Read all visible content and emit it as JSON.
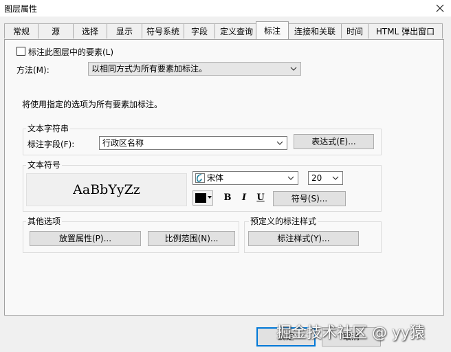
{
  "window": {
    "title": "图层属性"
  },
  "tabs": [
    {
      "label": "常规"
    },
    {
      "label": "源"
    },
    {
      "label": "选择"
    },
    {
      "label": "显示"
    },
    {
      "label": "符号系统"
    },
    {
      "label": "字段"
    },
    {
      "label": "定义查询"
    },
    {
      "label": "标注"
    },
    {
      "label": "连接和关联"
    },
    {
      "label": "时间"
    },
    {
      "label": "HTML 弹出窗口"
    }
  ],
  "labeling": {
    "enable_label": "标注此图层中的要素(L)",
    "method_label": "方法(M):",
    "method_value": "以相同方式为所有要素加标注。",
    "info_text": "将使用指定的选项为所有要素加标注。",
    "text_string": {
      "group_title": "文本字符串",
      "field_label": "标注字段(F):",
      "field_value": "行政区名称",
      "expression_button": "表达式(E)..."
    },
    "text_symbol": {
      "group_title": "文本符号",
      "preview_text": "AaBbYyZz",
      "font_value": "宋体",
      "size_value": "20",
      "color": "#000000",
      "bold": "B",
      "italic": "I",
      "underline": "U",
      "symbol_button": "符号(S)..."
    },
    "other_options": {
      "group_title": "其他选项",
      "placement_button": "放置属性(P)...",
      "scale_button": "比例范围(N)..."
    },
    "predefined": {
      "group_title": "预定义的标注样式",
      "style_button": "标注样式(Y)..."
    }
  },
  "footer": {
    "ok": "确定",
    "cancel": "取消"
  },
  "watermark": "掘金技术社区 @ yy猿"
}
